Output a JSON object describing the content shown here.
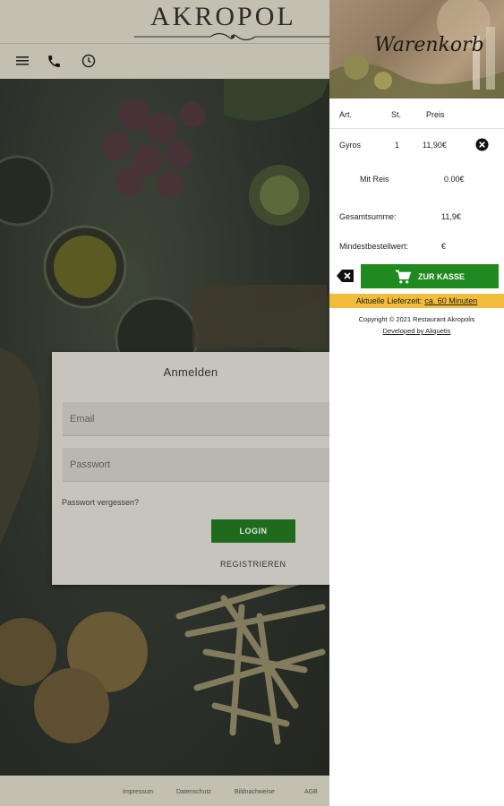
{
  "header": {
    "logo_text": "AKROPOL"
  },
  "login": {
    "title": "Anmelden",
    "email_placeholder": "Email",
    "password_placeholder": "Passwort",
    "forgot_label": "Passwort vergessen?",
    "login_label": "LOGIN",
    "register_label": "REGISTRIEREN"
  },
  "footer": {
    "links": [
      "Impressum",
      "Datenschutz",
      "Bildnachweise",
      "AGB"
    ]
  },
  "cart": {
    "title": "Warenkorb",
    "columns": [
      "Art.",
      "St.",
      "Preis"
    ],
    "item": {
      "name": "Gyros",
      "qty": "1",
      "price": "11,90€"
    },
    "option": {
      "name": "Mit Reis",
      "price": "0.00€"
    },
    "total_label": "Gesamtsumme:",
    "total_value": "11,9€",
    "min_label": "Mindestbestellwert:",
    "min_value": "€",
    "checkout_label": "ZUR KASSE",
    "delivery_label": "Aktuelle Lieferzeit:",
    "delivery_value": "ca. 60 Minuten",
    "copyright": "Copyright © 2021 Restaurant Akropolis",
    "developer": "Developed by Aliquetis"
  },
  "colors": {
    "accent_green": "#1f8a1f",
    "login_green": "#1e6b1e",
    "delivery_yellow": "#f2bd3d"
  }
}
